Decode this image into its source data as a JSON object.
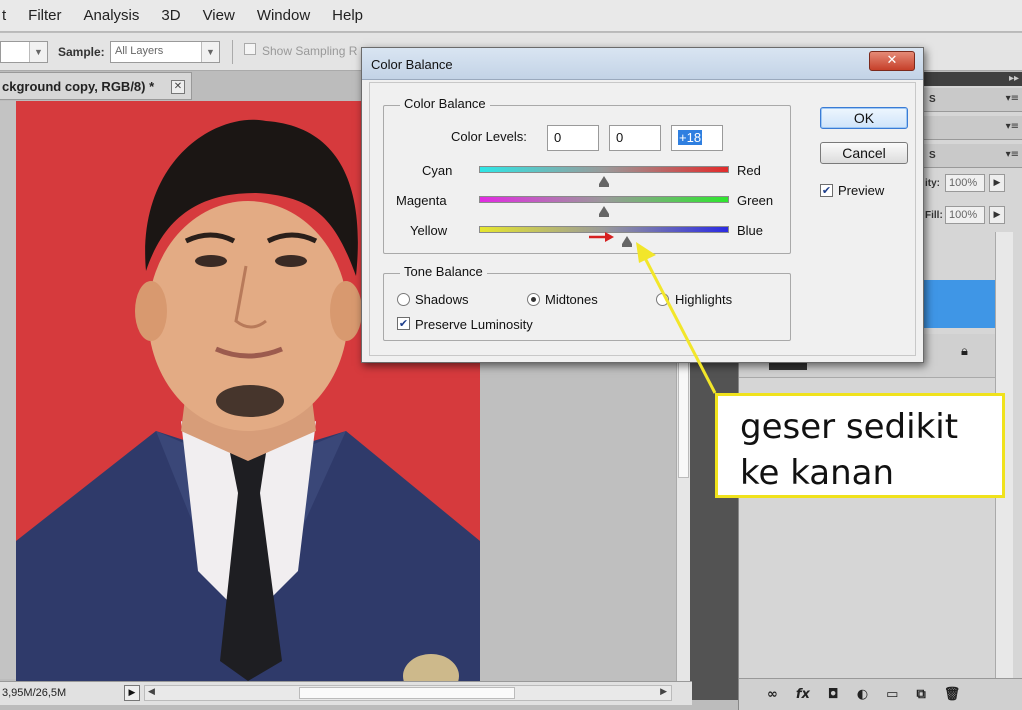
{
  "menubar": {
    "items": [
      "t",
      "Filter",
      "Analysis",
      "3D",
      "View",
      "Window",
      "Help"
    ]
  },
  "options_bar": {
    "sample_label": "Sample:",
    "sample_value": "All Layers",
    "show_sampling_label": "Show Sampling R"
  },
  "document": {
    "tab_label": "ckground copy, RGB/8) *",
    "close_glyph": "✕"
  },
  "status": {
    "doc_size": "3,95M/26,5M"
  },
  "panels": {
    "panel_label_1": "S",
    "panel_label_2": "S",
    "opacity_label": "ity:",
    "opacity_value": "100%",
    "fill_label": "Fill:",
    "fill_value": "100%"
  },
  "dialog": {
    "title": "Color Balance",
    "close_glyph": "✕",
    "color_balance_group": "Color Balance",
    "color_levels_label": "Color Levels:",
    "levels": [
      "0",
      "0",
      "+18"
    ],
    "sliders": [
      {
        "left": "Cyan",
        "right": "Red",
        "value": 0
      },
      {
        "left": "Magenta",
        "right": "Green",
        "value": 0
      },
      {
        "left": "Yellow",
        "right": "Blue",
        "value": 18
      }
    ],
    "slider_range": [
      -100,
      100
    ],
    "tone_balance_group": "Tone Balance",
    "tones": [
      "Shadows",
      "Midtones",
      "Highlights"
    ],
    "selected_tone": "Midtones",
    "preserve_luminosity_label": "Preserve Luminosity",
    "preserve_luminosity_checked": true,
    "ok_label": "OK",
    "cancel_label": "Cancel",
    "preview_label": "Preview",
    "preview_checked": true
  },
  "annotation": {
    "line1": "geser sedikit",
    "line2": "ke kanan",
    "border_color": "#f0e21c",
    "arrow_color": "#f2e62a",
    "small_arrow_color": "#d62020"
  }
}
